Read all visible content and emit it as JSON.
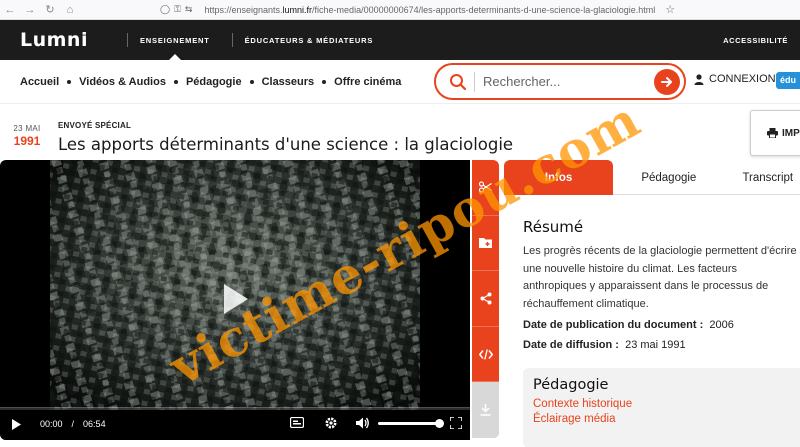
{
  "browser": {
    "url_prefix": "https://enseignants.",
    "url_domain": "lumni.fr",
    "url_path": "/fiche-media/00000000674/les-apports-determinants-d-une-science-la-glaciologie.html"
  },
  "header": {
    "logo": "Lumni",
    "links": [
      "ENSEIGNEMENT",
      "ÉDUCATEURS & MÉDIATEURS"
    ],
    "accessibility": "ACCESSIBILITÉ"
  },
  "nav": {
    "items": [
      "Accueil",
      "Vidéos & Audios",
      "Pédagogie",
      "Classeurs",
      "Offre cinéma"
    ],
    "search_placeholder": "Rechercher...",
    "login": "CONNEXION",
    "badge": "édu"
  },
  "media": {
    "date_day": "23 MAI",
    "date_year": "1991",
    "surtitle": "ENVOYÉ SPÉCIAL",
    "title": "Les apports déterminants d'une science : la glaciologie",
    "print_label": "IMP"
  },
  "player": {
    "current_time": "00:00",
    "separator": "/",
    "duration": "06:54",
    "progress": 0,
    "volume": 1.0
  },
  "tabs": [
    "Infos",
    "Pédagogie",
    "Transcript"
  ],
  "info": {
    "heading": "Résumé",
    "summary": "Les progrès récents de la glaciologie permettent d'écrire une nouvelle histoire du climat. Les facteurs anthropiques y apparaissent dans le processus de réchauffement climatique.",
    "pub_label": "Date de publication du document :",
    "pub_value": "2006",
    "diff_label": "Date de diffusion :",
    "diff_value": "23 mai 1991"
  },
  "pedagogie": {
    "title": "Pédagogie",
    "links": [
      "Contexte historique",
      "Éclairage média"
    ]
  },
  "watermark": "victime-ripou.com",
  "colors": {
    "accent": "#e8431c",
    "header_bg": "#1c1c1c",
    "badge": "#2591d8",
    "watermark": "#ff9500"
  }
}
